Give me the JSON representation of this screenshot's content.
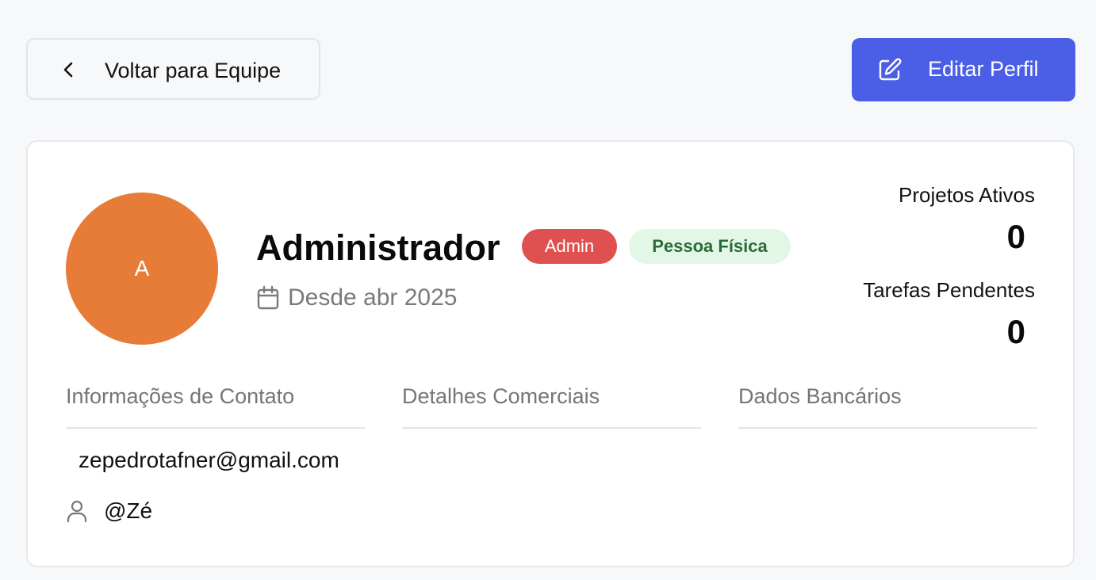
{
  "header": {
    "back_label": "Voltar para Equipe",
    "edit_label": "Editar Perfil"
  },
  "profile": {
    "avatar_initial": "A",
    "name": "Administrador",
    "role_badge": "Admin",
    "type_badge": "Pessoa Física",
    "since": "Desde abr 2025"
  },
  "stats": {
    "active_projects_label": "Projetos Ativos",
    "active_projects_value": "0",
    "pending_tasks_label": "Tarefas Pendentes",
    "pending_tasks_value": "0"
  },
  "tabs": [
    {
      "label": "Informações de Contato"
    },
    {
      "label": "Detalhes Comerciais"
    },
    {
      "label": "Dados Bancários"
    }
  ],
  "contact": {
    "email": "zepedrotafner@gmail.com",
    "username": "@Zé"
  },
  "colors": {
    "primary": "#4a5ee6",
    "avatar": "#e77c38",
    "admin_badge": "#df5151",
    "type_badge_bg": "#e2f7e6",
    "type_badge_text": "#2c6a38"
  },
  "icons": {
    "back": "chevron-left-icon",
    "edit": "edit-icon",
    "since": "calendar-icon",
    "user": "user-icon"
  }
}
